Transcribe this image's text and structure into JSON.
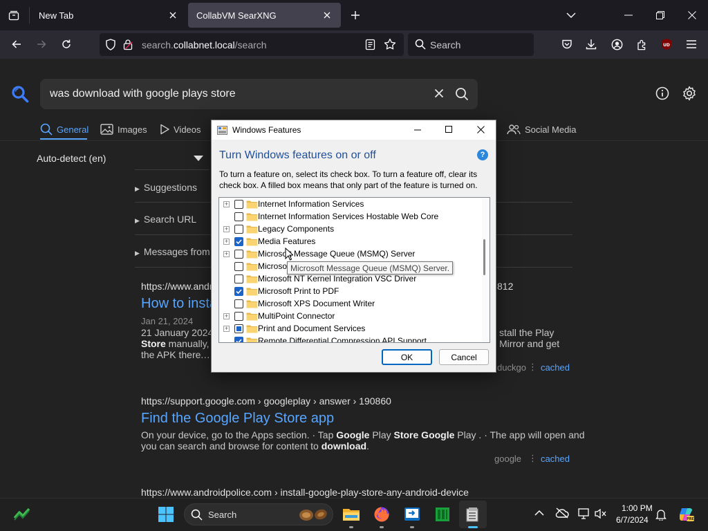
{
  "browser": {
    "tabs": [
      {
        "title": "New Tab"
      },
      {
        "title": "CollabVM SearXNG"
      }
    ],
    "url": {
      "prefix": "search.",
      "domain": "collabnet.local",
      "path": "/search"
    },
    "search_placeholder": "Search"
  },
  "searx": {
    "query": "was download with google plays store",
    "categories": [
      {
        "label": "General"
      },
      {
        "label": "Images"
      },
      {
        "label": "Videos"
      },
      {
        "label": "Social Media"
      }
    ],
    "language": "Auto-detect (en)",
    "sidebar": [
      "Suggestions",
      "Search URL",
      "Messages from"
    ],
    "results": [
      {
        "url": "https://www.andr",
        "url_tail": "812",
        "title": "How to insta",
        "date": "Jan 21, 2024",
        "snippet_left_1": "21 January 2024",
        "snippet_right_1": "stall the Play",
        "snippet_left_2_bold": "Store",
        "snippet_left_2": " manually, ",
        "snippet_left_2_cut": "c",
        "snippet_right_2": "Mirror and get",
        "snippet_left_3": "the APK there.…",
        "engine": "duckgo",
        "cached": "cached"
      },
      {
        "url_host": "https://support.google.com",
        "url_path": "› googleplay › answer › 190860",
        "title": "Find the Google Play Store app",
        "snippet_1a": "On your device, go to the Apps section. · Tap ",
        "snippet_1b": "Google",
        "snippet_1c": " Play ",
        "snippet_1d": "Store Google",
        "snippet_1e": " Play . · The app will open and",
        "snippet_2a": "you can search and browse for content to ",
        "snippet_2b": "download",
        "snippet_2c": ".",
        "engine": "google",
        "cached": "cached"
      },
      {
        "url_host": "https://www.androidpolice.com",
        "url_path": "› install-google-play-store-any-android-device"
      }
    ]
  },
  "dialog": {
    "title": "Windows Features",
    "heading": "Turn Windows features on or off",
    "help": "?",
    "description_1": "To turn a feature on, select its check box. To turn a feature off, clear its",
    "description_2": "check box. A filled box means that only part of the feature is turned on.",
    "features": [
      {
        "label": "Internet Information Services",
        "expandable": true,
        "state": "unchecked"
      },
      {
        "label": "Internet Information Services Hostable Web Core",
        "expandable": false,
        "state": "unchecked"
      },
      {
        "label": "Legacy Components",
        "expandable": true,
        "state": "unchecked"
      },
      {
        "label": "Media Features",
        "expandable": true,
        "state": "checked"
      },
      {
        "label": "Microsoft Message Queue (MSMQ) Server",
        "expandable": true,
        "state": "unchecked"
      },
      {
        "label": "Microsoft",
        "expandable": false,
        "state": "unchecked"
      },
      {
        "label": "Microsoft NT Kernel Integration VSC Driver",
        "expandable": false,
        "state": "unchecked"
      },
      {
        "label": "Microsoft Print to PDF",
        "expandable": false,
        "state": "checked"
      },
      {
        "label": "Microsoft XPS Document Writer",
        "expandable": false,
        "state": "unchecked"
      },
      {
        "label": "MultiPoint Connector",
        "expandable": true,
        "state": "unchecked"
      },
      {
        "label": "Print and Document Services",
        "expandable": true,
        "state": "partial"
      },
      {
        "label": "Remote Differential Compression API Support",
        "expandable": false,
        "state": "checked"
      }
    ],
    "tooltip": "Microsoft Message Queue (MSMQ) Server.",
    "ok": "OK",
    "cancel": "Cancel"
  },
  "taskbar": {
    "search": "Search",
    "time": "1:00 PM",
    "date": "6/7/2024"
  },
  "colors": {
    "accent_link": "#58a6ff",
    "searx_accent": "#3d7cf5",
    "win_accent": "#1a63c9",
    "ublock": "#800000"
  }
}
